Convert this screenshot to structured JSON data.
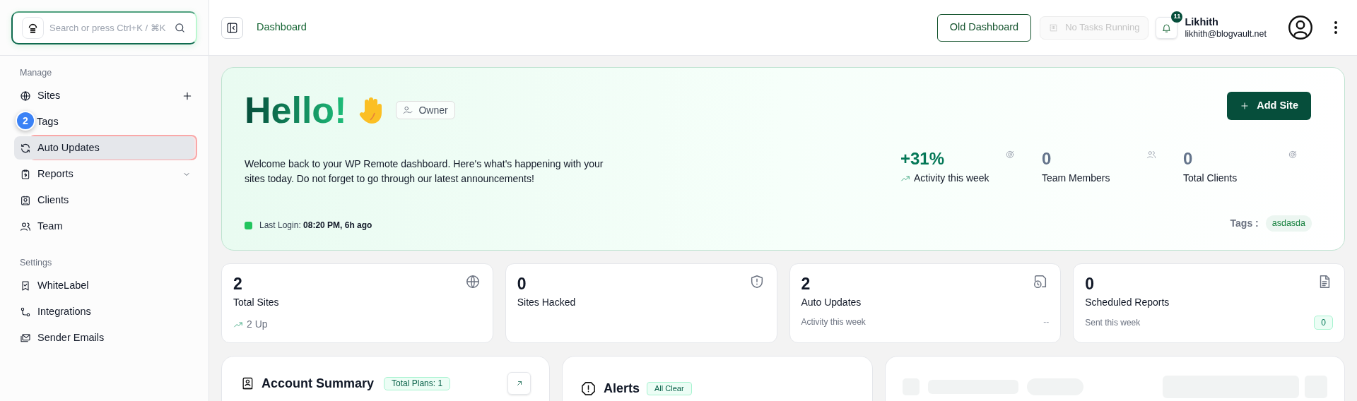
{
  "search": {
    "placeholder": "Search or press Ctrl+K / ⌘K"
  },
  "sidebar": {
    "sections": [
      {
        "title": "Manage",
        "items": [
          {
            "label": "Sites",
            "kind": "add",
            "selected": false,
            "highlighted": false
          },
          {
            "label": "Tags",
            "kind": "plain",
            "selected": false,
            "highlighted": false,
            "step_badge": "2"
          },
          {
            "label": "Auto Updates",
            "kind": "plain",
            "selected": true,
            "highlighted": true
          },
          {
            "label": "Reports",
            "kind": "expand",
            "selected": false,
            "highlighted": false
          },
          {
            "label": "Clients",
            "kind": "plain",
            "selected": false,
            "highlighted": false
          },
          {
            "label": "Team",
            "kind": "plain",
            "selected": false,
            "highlighted": false
          }
        ]
      },
      {
        "title": "Settings",
        "items": [
          {
            "label": "WhiteLabel",
            "kind": "plain",
            "selected": false,
            "highlighted": false
          },
          {
            "label": "Integrations",
            "kind": "plain",
            "selected": false,
            "highlighted": false
          },
          {
            "label": "Sender Emails",
            "kind": "plain",
            "selected": false,
            "highlighted": false
          }
        ]
      }
    ]
  },
  "header": {
    "breadcrumb": "Dashboard",
    "old_dashboard": "Old Dashboard",
    "tasks": {
      "label": "No Tasks Running",
      "disabled": true
    },
    "notifications": "11",
    "user": {
      "name": "Likhith",
      "email": "likhith@blogvault.net"
    }
  },
  "hero": {
    "greeting": "Hello!",
    "role": "Owner",
    "welcome": "Welcome back to your WP Remote dashboard. Here's what's happening with your sites today. Do not forget to go through our latest announcements!",
    "last_login_label": "Last Login:",
    "last_login": "08:20 PM, 6h ago",
    "add_site": "Add Site",
    "stats": [
      {
        "value": "+31%",
        "label": "Activity this week",
        "kind": "trend"
      },
      {
        "value": "0",
        "label": "Team Members",
        "kind": "plain"
      },
      {
        "value": "0",
        "label": "Total Clients",
        "kind": "plain"
      }
    ],
    "tags_label": "Tags :",
    "tags": [
      "asdasda"
    ]
  },
  "stat_cards": [
    {
      "value": "2",
      "label": "Total Sites",
      "kind": "trend",
      "footer": "2 Up"
    },
    {
      "value": "0",
      "label": "Sites Hacked",
      "kind": "none"
    },
    {
      "value": "2",
      "label": "Auto Updates",
      "kind": "note",
      "footer": "Activity this week",
      "aside": "--"
    },
    {
      "value": "0",
      "label": "Scheduled Reports",
      "kind": "count",
      "footer": "Sent this week",
      "aside": "0"
    }
  ],
  "panels": [
    {
      "kind": "account",
      "title": "Account Summary",
      "badge": "Total Plans: 1"
    },
    {
      "kind": "alerts",
      "title": "Alerts",
      "badge": "All Clear"
    },
    {
      "kind": "skeleton"
    }
  ]
}
